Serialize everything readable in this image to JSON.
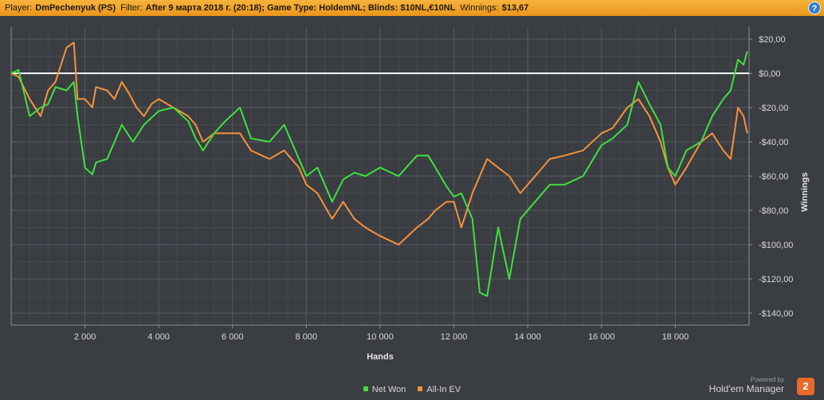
{
  "header": {
    "player_label": "Player:",
    "player_value": "DmPechenyuk (PS)",
    "filter_label": "Filter:",
    "filter_value": "After 9 марта 2018 г. (20:18); Game Type: HoldemNL; Blinds: $10NL,€10NL",
    "winnings_label": "Winnings:",
    "winnings_value": "$13,67",
    "help_glyph": "?"
  },
  "colors": {
    "background": "#3a3d42",
    "plot_background": "#3a3d42",
    "grid_major": "#585c62",
    "grid_minor": "#46494e",
    "zero_line": "#ffffff",
    "net_won": "#3fe03f",
    "all_in_ev": "#f5923a",
    "header": "#f0a429"
  },
  "chart_data": {
    "type": "line",
    "title": "",
    "xlabel": "Hands",
    "ylabel": "Winnings",
    "xlim": [
      0,
      20000
    ],
    "ylim": [
      -147,
      27
    ],
    "x_ticks": [
      2000,
      4000,
      6000,
      8000,
      10000,
      12000,
      14000,
      16000,
      18000
    ],
    "x_tick_labels": [
      "2 000",
      "4 000",
      "6 000",
      "8 000",
      "10 000",
      "12 000",
      "14 000",
      "16 000",
      "18 000"
    ],
    "y_ticks": [
      20,
      0,
      -20,
      -40,
      -60,
      -80,
      -100,
      -120,
      -140
    ],
    "y_tick_labels": [
      "$20,00",
      "$0,00",
      "-$20,00",
      "-$40,00",
      "-$60,00",
      "-$80,00",
      "-$100,00",
      "-$120,00",
      "-$140,00"
    ],
    "grid": true,
    "legend_position": "bottom-center",
    "series": [
      {
        "name": "Net Won",
        "color": "#3fe03f",
        "x": [
          0,
          200,
          500,
          800,
          1000,
          1200,
          1500,
          1700,
          1800,
          2000,
          2200,
          2300,
          2600,
          3000,
          3300,
          3600,
          4000,
          4400,
          4800,
          5000,
          5200,
          5500,
          5800,
          6200,
          6500,
          7000,
          7400,
          7800,
          8000,
          8300,
          8700,
          9000,
          9300,
          9600,
          10000,
          10500,
          11000,
          11300,
          11500,
          11800,
          12000,
          12200,
          12500,
          12700,
          12900,
          13200,
          13500,
          13800,
          14200,
          14600,
          15000,
          15500,
          16000,
          16300,
          16700,
          17000,
          17300,
          17600,
          17800,
          18000,
          18300,
          18700,
          19000,
          19300,
          19500,
          19700,
          19850,
          19950
        ],
        "y": [
          0,
          2,
          -25,
          -20,
          -18,
          -8,
          -10,
          -5,
          -25,
          -55,
          -59,
          -52,
          -50,
          -30,
          -40,
          -30,
          -22,
          -20,
          -28,
          -38,
          -45,
          -35,
          -28,
          -20,
          -38,
          -40,
          -30,
          -50,
          -60,
          -55,
          -75,
          -62,
          -58,
          -60,
          -55,
          -60,
          -48,
          -48,
          -55,
          -66,
          -72,
          -70,
          -85,
          -128,
          -130,
          -90,
          -120,
          -85,
          -75,
          -65,
          -65,
          -60,
          -42,
          -38,
          -30,
          -5,
          -18,
          -30,
          -55,
          -60,
          -45,
          -40,
          -25,
          -15,
          -10,
          8,
          5,
          13
        ]
      },
      {
        "name": "All-In EV",
        "color": "#f5923a",
        "x": [
          0,
          200,
          500,
          800,
          1000,
          1200,
          1500,
          1700,
          1800,
          2000,
          2200,
          2300,
          2600,
          2800,
          3000,
          3200,
          3400,
          3600,
          3800,
          4000,
          4400,
          4800,
          5000,
          5200,
          5500,
          5800,
          6200,
          6500,
          7000,
          7400,
          7800,
          8000,
          8300,
          8700,
          9000,
          9300,
          9600,
          10000,
          10500,
          11000,
          11300,
          11500,
          11800,
          12000,
          12200,
          12500,
          12700,
          12900,
          13200,
          13500,
          13800,
          14200,
          14600,
          15000,
          15500,
          16000,
          16300,
          16700,
          17000,
          17300,
          17600,
          17800,
          18000,
          18300,
          18700,
          19000,
          19300,
          19500,
          19700,
          19850,
          19950
        ],
        "y": [
          0,
          -2,
          -15,
          -25,
          -10,
          -5,
          15,
          18,
          -15,
          -15,
          -20,
          -8,
          -10,
          -15,
          -5,
          -12,
          -20,
          -25,
          -18,
          -15,
          -20,
          -25,
          -30,
          -40,
          -35,
          -35,
          -35,
          -45,
          -50,
          -45,
          -55,
          -65,
          -70,
          -85,
          -75,
          -85,
          -90,
          -95,
          -100,
          -90,
          -85,
          -80,
          -75,
          -75,
          -90,
          -70,
          -60,
          -50,
          -55,
          -60,
          -70,
          -60,
          -50,
          -48,
          -45,
          -35,
          -32,
          -20,
          -15,
          -25,
          -40,
          -55,
          -65,
          -55,
          -40,
          -35,
          -45,
          -50,
          -20,
          -25,
          -35
        ]
      }
    ]
  },
  "legend": {
    "items": [
      {
        "label": "Net Won",
        "color": "#3fe03f"
      },
      {
        "label": "All-In EV",
        "color": "#f5923a"
      }
    ]
  },
  "branding": {
    "powered_by": "Powered by",
    "product": "Hold'em Manager",
    "badge": "2"
  }
}
